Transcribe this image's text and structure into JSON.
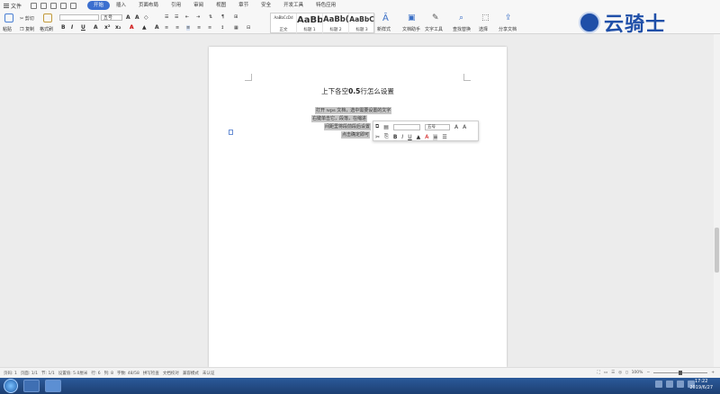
{
  "menubar": {
    "file_label": "文件",
    "tabs": [
      {
        "label": "开始",
        "active": true
      },
      {
        "label": "插入",
        "active": false
      },
      {
        "label": "页面布局",
        "active": false
      },
      {
        "label": "引用",
        "active": false
      },
      {
        "label": "审阅",
        "active": false
      },
      {
        "label": "视图",
        "active": false
      },
      {
        "label": "章节",
        "active": false
      },
      {
        "label": "安全",
        "active": false
      },
      {
        "label": "开发工具",
        "active": false
      },
      {
        "label": "特色应用",
        "active": false
      }
    ]
  },
  "ribbon": {
    "paste_label": "粘贴",
    "cut_label": "剪切",
    "copy_label": "复制",
    "format_painter_label": "格式刷",
    "font_size_value": "五号",
    "styles": [
      {
        "sample": "AaBbCcDd",
        "label": "正文"
      },
      {
        "sample": "AaBb",
        "label": "标题 1"
      },
      {
        "sample": "AaBb(",
        "label": "标题 2"
      },
      {
        "sample": "AaBbC",
        "label": "标题 3"
      }
    ],
    "new_style_label": "新样式",
    "doc_assist_label": "文档助手",
    "text_tools_label": "文字工具",
    "find_replace_label": "查找替换",
    "select_label": "选择",
    "share_label": "分享文档"
  },
  "logo_text": "云骑士",
  "document": {
    "title_pre": "上下各空",
    "title_num": "0.5",
    "title_post": "行怎么设置",
    "lines": [
      "打开 wps 文档，选中需要设置的文字",
      "右键单击它，段落，在缩进",
      "间距里将段前段后设置",
      "点击确定即可"
    ]
  },
  "mini_toolbar": {
    "font_size_value": "五号"
  },
  "statusbar": {
    "page_num": "页码: 1",
    "pages": "页面: 1/1",
    "section": "节: 1/1",
    "position": "设置值: 5.0厘米",
    "row": "行: 6",
    "col": "列: 8",
    "words": "字数: 48/58",
    "spellcheck": "拼写检查",
    "doc_check": "文档校对",
    "compat_mode": "兼容模式",
    "unverified": "未认证",
    "zoom": "100%"
  },
  "taskbar": {
    "time": "17:22",
    "date": "2019/6/27"
  }
}
